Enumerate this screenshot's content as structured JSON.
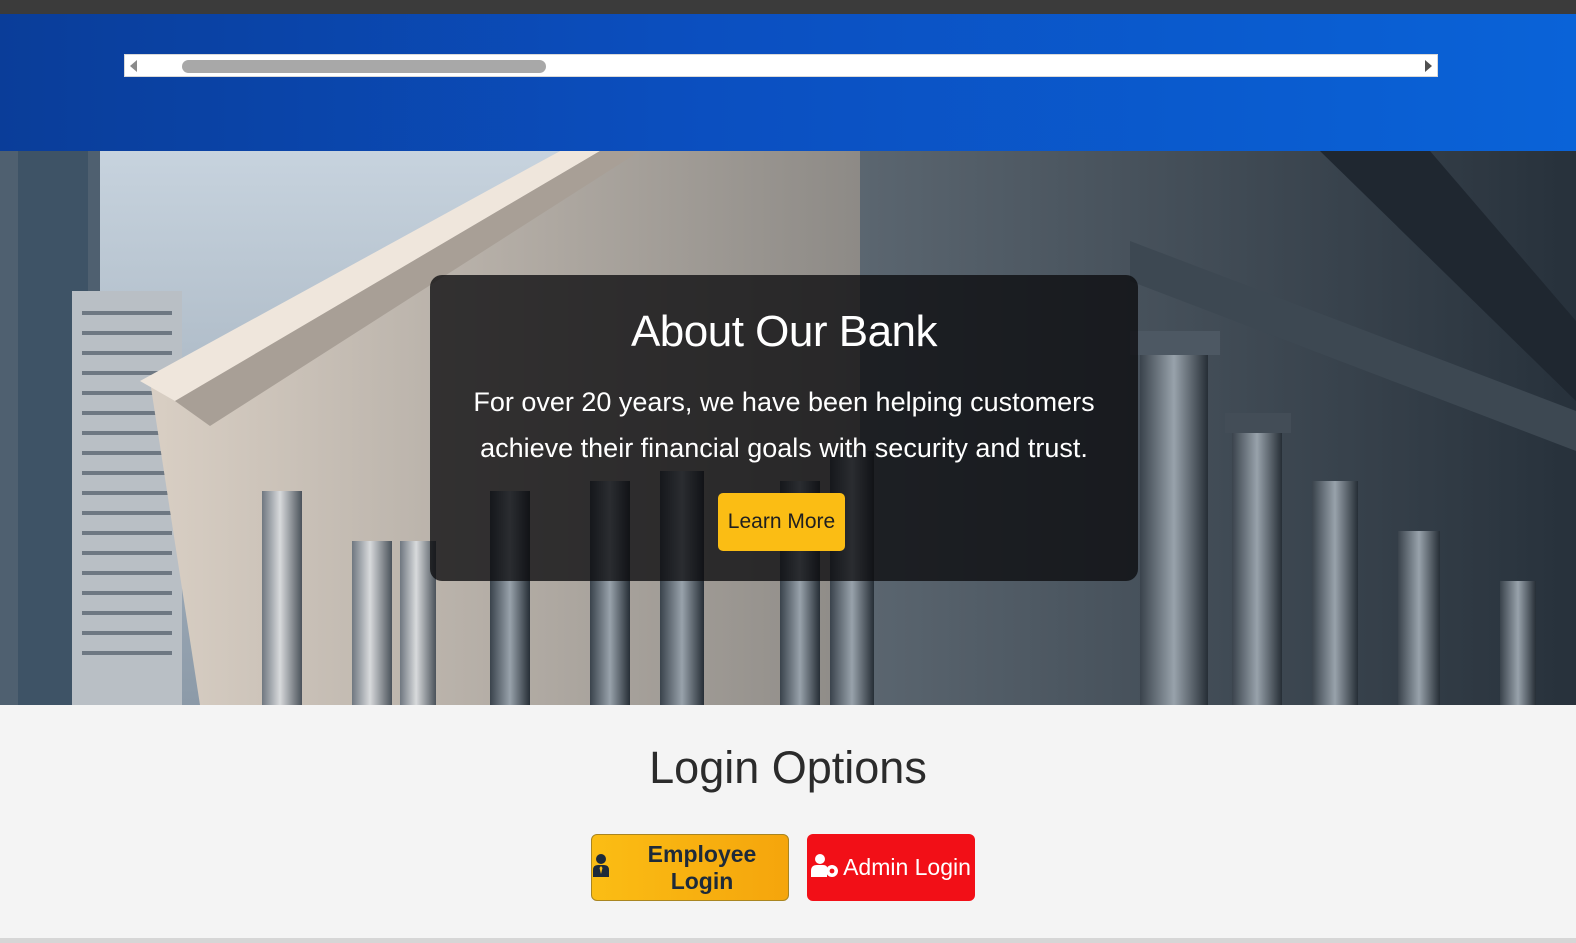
{
  "hero": {
    "title": "About Our Bank",
    "description": "For over 20 years, we have been helping customers achieve their financial goals with security and trust.",
    "button_label": "Learn More"
  },
  "login": {
    "title": "Login Options",
    "employee_label": "Employee Login",
    "admin_label": "Admin Login",
    "employee_icon": "user-tie-icon",
    "admin_icon": "user-gear-icon"
  },
  "colors": {
    "header_blue": "#0b4fc0",
    "accent_yellow": "#fbbd14",
    "admin_red": "#f20f17"
  }
}
